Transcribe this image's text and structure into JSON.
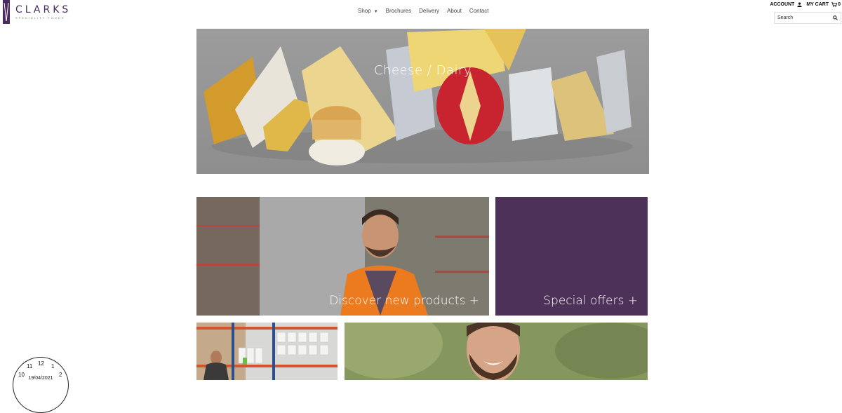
{
  "brand": {
    "name": "CLARKS",
    "tagline": "SPECIALITY FOODS",
    "color": "#4a2c5e"
  },
  "nav": {
    "items": [
      {
        "label": "Shop",
        "has_dropdown": true
      },
      {
        "label": "Brochures"
      },
      {
        "label": "Delivery"
      },
      {
        "label": "About"
      },
      {
        "label": "Contact"
      }
    ]
  },
  "header": {
    "account_label": "ACCOUNT",
    "cart_label": "MY CART",
    "cart_count": "0",
    "search_placeholder": "Search"
  },
  "hero": {
    "title": "Cheese / Dairy"
  },
  "tiles": {
    "discover": {
      "label": "Discover new products +"
    },
    "offers": {
      "label": "Special offers +",
      "color": "#4d3158"
    }
  },
  "clock": {
    "numbers": {
      "n12": "12",
      "n1": "1",
      "n2": "2",
      "n11": "11",
      "n10": "10"
    },
    "date": "19/04/2021"
  }
}
